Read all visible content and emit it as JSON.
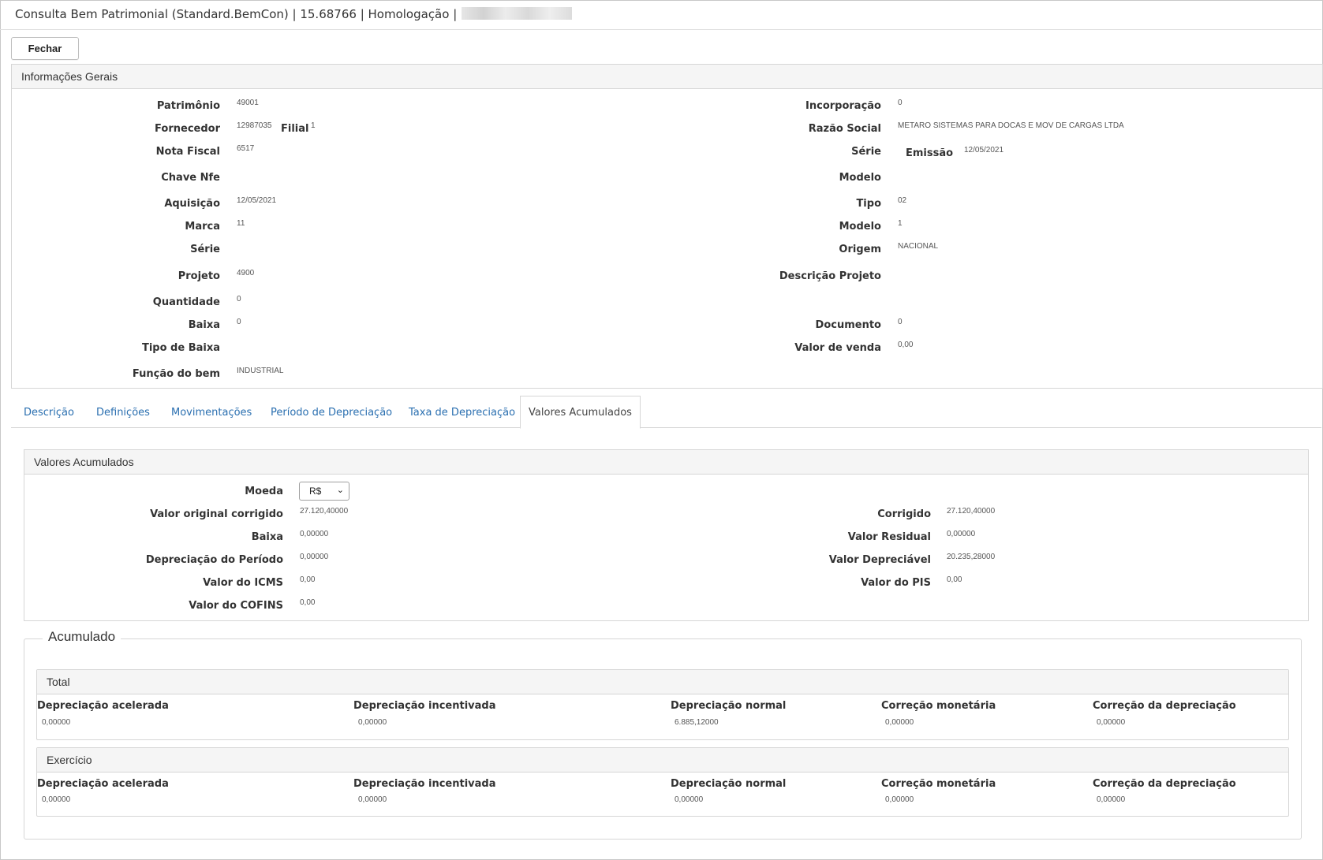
{
  "window": {
    "title": "Consulta Bem Patrimonial (Standard.BemCon) | 15.68766 | Homologação |"
  },
  "toolbar": {
    "close_label": "Fechar"
  },
  "info": {
    "title": "Informações Gerais",
    "patrimonio": {
      "label": "Patrimônio",
      "value": "49001"
    },
    "incorporacao": {
      "label": "Incorporação",
      "value": "0"
    },
    "fornecedor": {
      "label": "Fornecedor",
      "value": "12987035"
    },
    "filial": {
      "label": "Filial",
      "value": "1"
    },
    "razao_social": {
      "label": "Razão Social",
      "value": "METARO SISTEMAS PARA DOCAS E MOV DE CARGAS LTDA"
    },
    "nota_fiscal": {
      "label": "Nota Fiscal",
      "value": "6517"
    },
    "serie_nf": {
      "label": "Série",
      "value": ""
    },
    "emissao": {
      "label": "Emissão",
      "value": "12/05/2021"
    },
    "chave_nfe": {
      "label": "Chave Nfe",
      "value": ""
    },
    "modelo_nf": {
      "label": "Modelo",
      "value": ""
    },
    "aquisicao": {
      "label": "Aquisição",
      "value": "12/05/2021"
    },
    "tipo": {
      "label": "Tipo",
      "value": "02"
    },
    "marca": {
      "label": "Marca",
      "value": "11"
    },
    "modelo": {
      "label": "Modelo",
      "value": "1"
    },
    "serie": {
      "label": "Série",
      "value": ""
    },
    "origem": {
      "label": "Origem",
      "value": "NACIONAL"
    },
    "projeto": {
      "label": "Projeto",
      "value": "4900"
    },
    "descricao_projeto": {
      "label": "Descrição Projeto",
      "value": ""
    },
    "quantidade": {
      "label": "Quantidade",
      "value": "0"
    },
    "baixa": {
      "label": "Baixa",
      "value": "0"
    },
    "documento": {
      "label": "Documento",
      "value": "0"
    },
    "tipo_baixa": {
      "label": "Tipo de Baixa",
      "value": ""
    },
    "valor_venda": {
      "label": "Valor de venda",
      "value": "0,00"
    },
    "funcao_bem": {
      "label": "Função do bem",
      "value": "INDUSTRIAL"
    }
  },
  "tabs": [
    "Descrição",
    "Definições",
    "Movimentações",
    "Período de Depreciação",
    "Taxa de Depreciação",
    "Valores Acumulados"
  ],
  "active_tab": "Valores Acumulados",
  "valores": {
    "title": "Valores Acumulados",
    "moeda": {
      "label": "Moeda",
      "value": "R$"
    },
    "valor_original_corrigido": {
      "label": "Valor original corrigido",
      "value": "27.120,40000"
    },
    "corrigido": {
      "label": "Corrigido",
      "value": "27.120,40000"
    },
    "baixa": {
      "label": "Baixa",
      "value": "0,00000"
    },
    "valor_residual": {
      "label": "Valor Residual",
      "value": "0,00000"
    },
    "depreciacao_periodo": {
      "label": "Depreciação do Período",
      "value": "0,00000"
    },
    "valor_depreciavel": {
      "label": "Valor Depreciável",
      "value": "20.235,28000"
    },
    "valor_icms": {
      "label": "Valor do ICMS",
      "value": "0,00"
    },
    "valor_pis": {
      "label": "Valor do PIS",
      "value": "0,00"
    },
    "valor_cofins": {
      "label": "Valor do COFINS",
      "value": "0,00"
    }
  },
  "acumulado": {
    "legend": "Acumulado",
    "columns": [
      "Depreciação acelerada",
      "Depreciação incentivada",
      "Depreciação normal",
      "Correção monetária",
      "Correção da depreciação"
    ],
    "total": {
      "title": "Total",
      "values": [
        "0,00000",
        "0,00000",
        "6.885,12000",
        "0,00000",
        "0,00000"
      ]
    },
    "exercicio": {
      "title": "Exercício",
      "values": [
        "0,00000",
        "0,00000",
        "0,00000",
        "0,00000",
        "0,00000"
      ]
    }
  },
  "colors": {
    "link": "#2a6fb0",
    "panel_header": "#f5f5f5",
    "border": "#d6d6d6"
  }
}
